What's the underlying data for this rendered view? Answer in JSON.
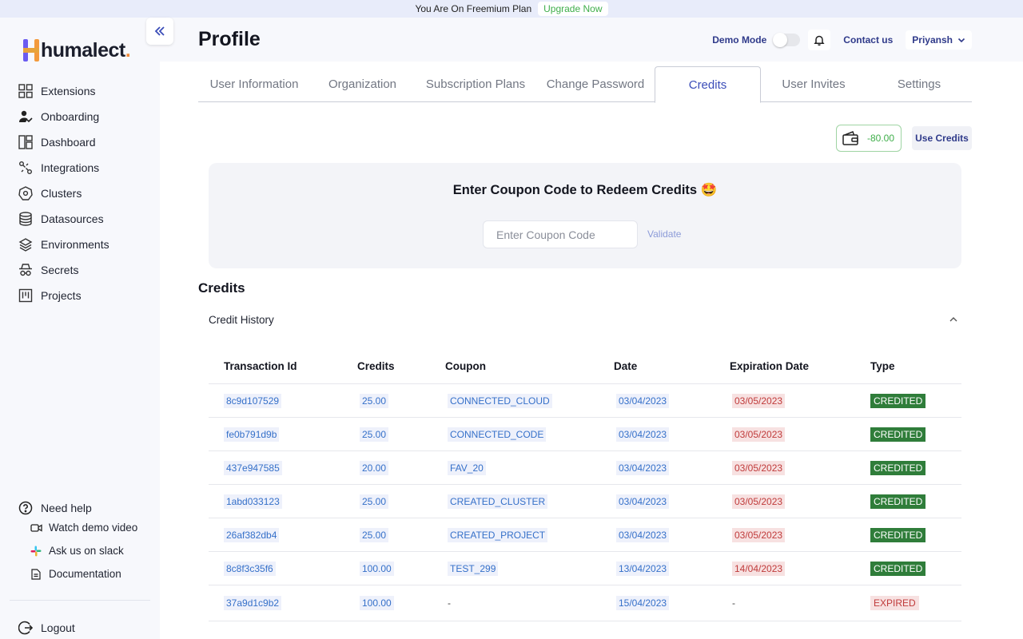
{
  "banner": {
    "text": "You Are On Freemium Plan",
    "upgrade_label": "Upgrade Now"
  },
  "brand": {
    "name": "humalect",
    "dot": "."
  },
  "sidebar": {
    "items": [
      {
        "label": "Extensions",
        "icon": "grid-icon"
      },
      {
        "label": "Onboarding",
        "icon": "user-check-icon"
      },
      {
        "label": "Dashboard",
        "icon": "layout-icon"
      },
      {
        "label": "Integrations",
        "icon": "integrations-icon"
      },
      {
        "label": "Clusters",
        "icon": "kubernetes-icon"
      },
      {
        "label": "Datasources",
        "icon": "database-icon"
      },
      {
        "label": "Environments",
        "icon": "layers-icon"
      },
      {
        "label": "Secrets",
        "icon": "spy-icon"
      },
      {
        "label": "Projects",
        "icon": "kanban-icon"
      }
    ],
    "help": {
      "title": "Need help",
      "links": [
        {
          "label": "Watch demo video",
          "icon": "video-icon"
        },
        {
          "label": "Ask us on slack",
          "icon": "slack-icon"
        },
        {
          "label": "Documentation",
          "icon": "document-icon"
        }
      ]
    },
    "logout_label": "Logout"
  },
  "header": {
    "title": "Profile",
    "demo_mode_label": "Demo Mode",
    "demo_mode_on": false,
    "contact_label": "Contact us",
    "user_name": "Priyansh"
  },
  "tabs": [
    {
      "label": "User Information",
      "active": false
    },
    {
      "label": "Organization",
      "active": false
    },
    {
      "label": "Subscription Plans",
      "active": false
    },
    {
      "label": "Change Password",
      "active": false
    },
    {
      "label": "Credits",
      "active": true
    },
    {
      "label": "User Invites",
      "active": false
    },
    {
      "label": "Settings",
      "active": false
    }
  ],
  "credits": {
    "balance": "-80.00",
    "use_credits_label": "Use Credits",
    "coupon_title": "Enter Coupon Code to Redeem Credits 🤩",
    "coupon_placeholder": "Enter Coupon Code",
    "validate_label": "Validate",
    "section_title": "Credits",
    "history_title": "Credit History"
  },
  "table": {
    "headers": [
      "Transaction Id",
      "Credits",
      "Coupon",
      "Date",
      "Expiration Date",
      "Type"
    ],
    "rows": [
      {
        "id": "8c9d107529",
        "credits": "25.00",
        "coupon": "CONNECTED_CLOUD",
        "date": "03/04/2023",
        "expiration": "03/05/2023",
        "type": "CREDITED"
      },
      {
        "id": "fe0b791d9b",
        "credits": "25.00",
        "coupon": "CONNECTED_CODE",
        "date": "03/04/2023",
        "expiration": "03/05/2023",
        "type": "CREDITED"
      },
      {
        "id": "437e947585",
        "credits": "20.00",
        "coupon": "FAV_20",
        "date": "03/04/2023",
        "expiration": "03/05/2023",
        "type": "CREDITED"
      },
      {
        "id": "1abd033123",
        "credits": "25.00",
        "coupon": "CREATED_CLUSTER",
        "date": "03/04/2023",
        "expiration": "03/05/2023",
        "type": "CREDITED"
      },
      {
        "id": "26af382db4",
        "credits": "25.00",
        "coupon": "CREATED_PROJECT",
        "date": "03/04/2023",
        "expiration": "03/05/2023",
        "type": "CREDITED"
      },
      {
        "id": "8c8f3c35f6",
        "credits": "100.00",
        "coupon": "TEST_299",
        "date": "13/04/2023",
        "expiration": "14/04/2023",
        "type": "CREDITED"
      },
      {
        "id": "37a9d1c9b2",
        "credits": "100.00",
        "coupon": "-",
        "date": "15/04/2023",
        "expiration": "-",
        "type": "EXPIRED"
      }
    ]
  },
  "colors": {
    "accent": "#3b4db8",
    "credited": "#2f7d3a",
    "expired_bg": "#f7e1e1",
    "balance": "#3fae4a"
  }
}
